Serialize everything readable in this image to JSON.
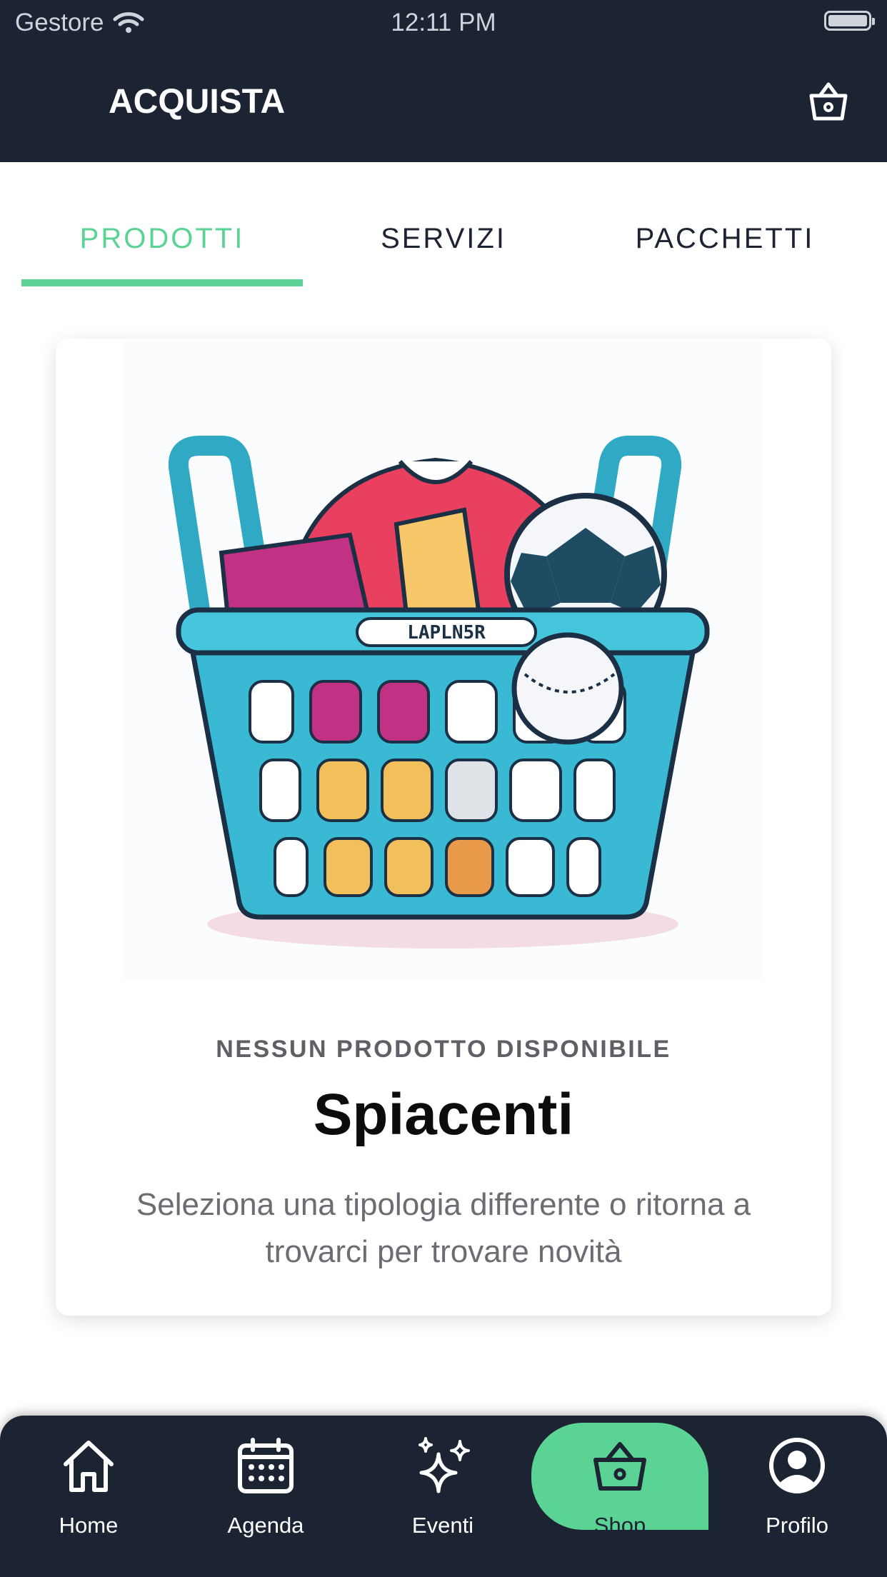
{
  "status_bar": {
    "carrier": "Gestore",
    "time": "12:11 PM"
  },
  "header": {
    "title": "ACQUISTA",
    "cart_icon": "basket-icon"
  },
  "tabs": [
    {
      "label": "PRODOTTI",
      "active": true
    },
    {
      "label": "SERVIZI",
      "active": false
    },
    {
      "label": "PACCHETTI",
      "active": false
    }
  ],
  "empty_state": {
    "image_label": "LAPLN5R",
    "subtitle": "NESSUN PRODOTTO DISPONIBILE",
    "title": "Spiacenti",
    "message": "Seleziona una tipologia differente o ritorna a trovarci per trovare novità"
  },
  "bottom_nav": [
    {
      "label": "Home",
      "icon": "home-icon",
      "active": false
    },
    {
      "label": "Agenda",
      "icon": "calendar-icon",
      "active": false
    },
    {
      "label": "Eventi",
      "icon": "sparkles-icon",
      "active": false
    },
    {
      "label": "Shop",
      "icon": "basket-icon",
      "active": true
    },
    {
      "label": "Profilo",
      "icon": "user-circle-icon",
      "active": false
    }
  ],
  "colors": {
    "primary_dark": "#1c2333",
    "accent": "#5ad394"
  }
}
